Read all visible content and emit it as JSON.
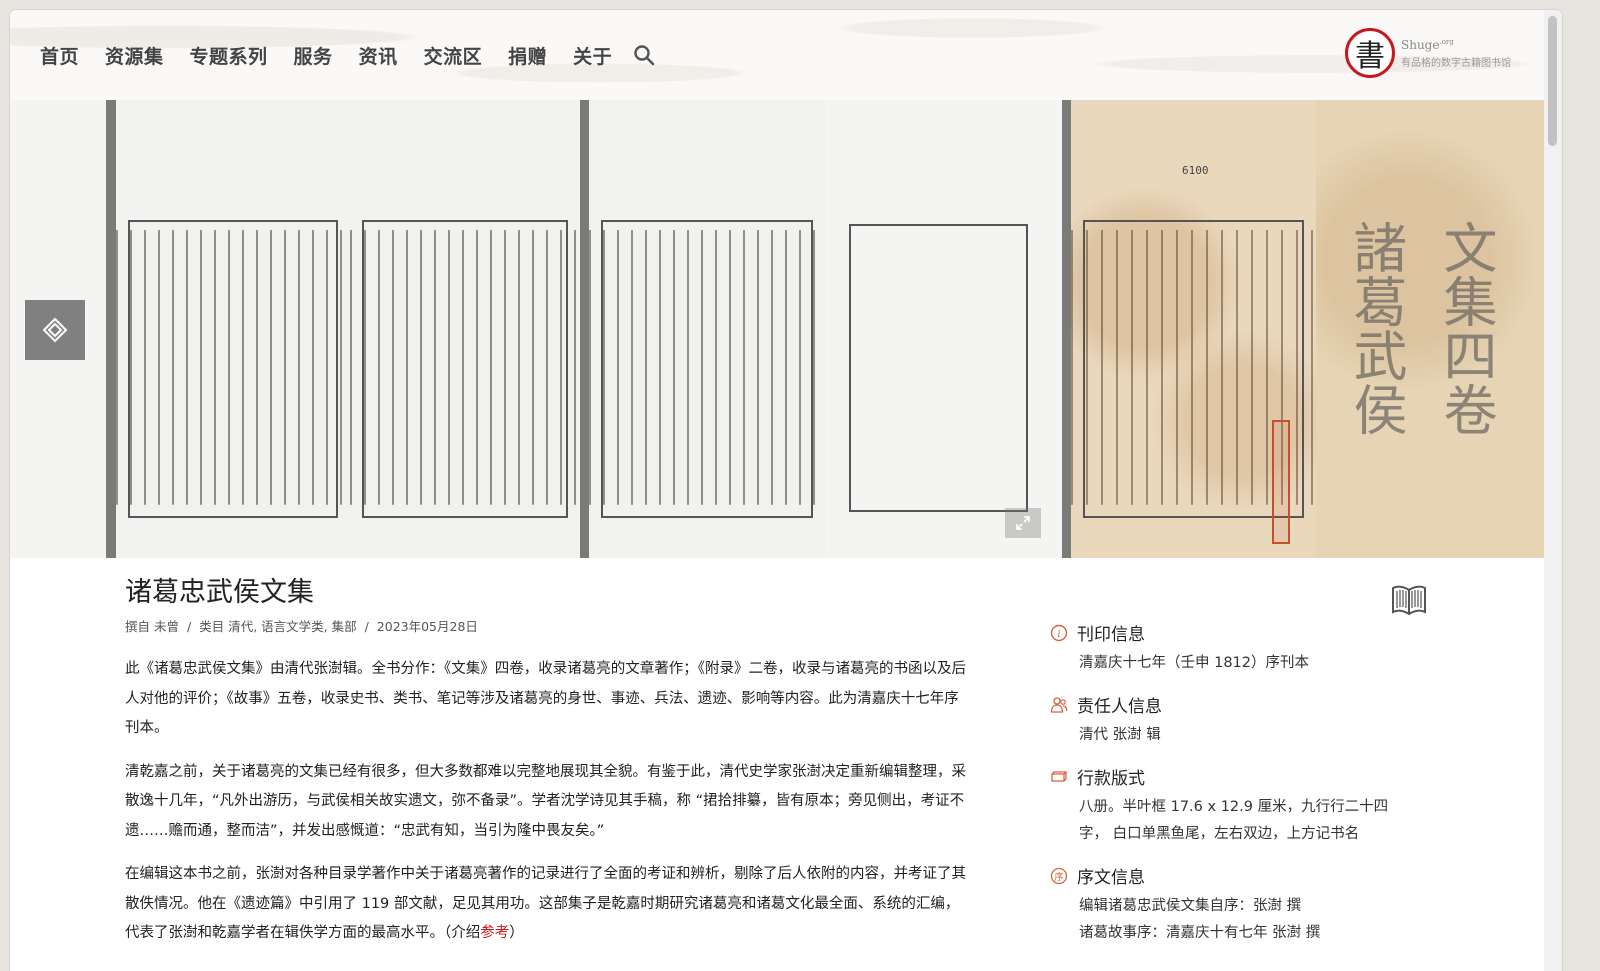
{
  "nav": {
    "items": [
      "首页",
      "资源集",
      "专题系列",
      "服务",
      "资讯",
      "交流区",
      "捐赠",
      "关于"
    ]
  },
  "logo": {
    "seal_char": "書",
    "name": "Shuge",
    "name_suffix": ".org",
    "slogan": "有品格的数字古籍图书馆"
  },
  "banner": {
    "page_number": "6100"
  },
  "article": {
    "title": "诸葛忠武侯文集",
    "meta": {
      "author_label": "撰自",
      "author": "未曾",
      "category_label": "类目",
      "categories": "清代, 语言文学类, 集部",
      "date": "2023年05月28日"
    },
    "paragraphs": [
      "此《诸葛忠武侯文集》由清代张澍辑。全书分作：《文集》四卷，收录诸葛亮的文章著作；《附录》二卷，收录与诸葛亮的书函以及后人对他的评价；《故事》五卷，收录史书、类书、笔记等涉及诸葛亮的身世、事迹、兵法、遗迹、影响等内容。此为清嘉庆十七年序刊本。",
      "清乾嘉之前，关于诸葛亮的文集已经有很多，但大多数都难以完整地展现其全貌。有鉴于此，清代史学家张澍决定重新编辑整理，采散逸十几年，“凡外出游历，与武侯相关故实遗文，弥不备录”。学者沈学诗见其手稿，称 “捃拾排纂，皆有原本；旁见侧出，考证不遗……赡而通，整而洁”，并发出感慨道：“忠武有知，当引为隆中畏友矣。”"
    ],
    "last_paragraph": "在编辑这本书之前，张澍对各种目录学著作中关于诸葛亮著作的记录进行了全面的考证和辨析，剔除了后人依附的内容，并考证了其散佚情况。他在《遗迹篇》中引用了 119 部文献，足见其用功。这部集子是乾嘉时期研究诸葛亮和诸葛文化最全面、系统的汇编，代表了张澍和乾嘉学者在辑佚学方面的最高水平。（介绍",
    "ref_link": "参考",
    "last_paragraph_end": "）"
  },
  "sidebar": {
    "print": {
      "title": "刊印信息",
      "body": "清嘉庆十七年（壬申 1812）序刊本"
    },
    "responsible": {
      "title": "责任人信息",
      "body": "清代 张澍 辑"
    },
    "format": {
      "title": "行款版式",
      "body": "八册。半叶框 17.6 x 12.9 厘米，九行行二十四字， 白口单黑鱼尾，左右双边，上方记书名"
    },
    "preface": {
      "title": "序文信息",
      "lines": [
        "编辑诸葛忠武侯文集自序：张澍 撰",
        "诸葛故事序：清嘉庆十有七年 张澍 撰"
      ]
    }
  },
  "colors": {
    "accent": "#c8171e",
    "icon": "#d9603c"
  }
}
